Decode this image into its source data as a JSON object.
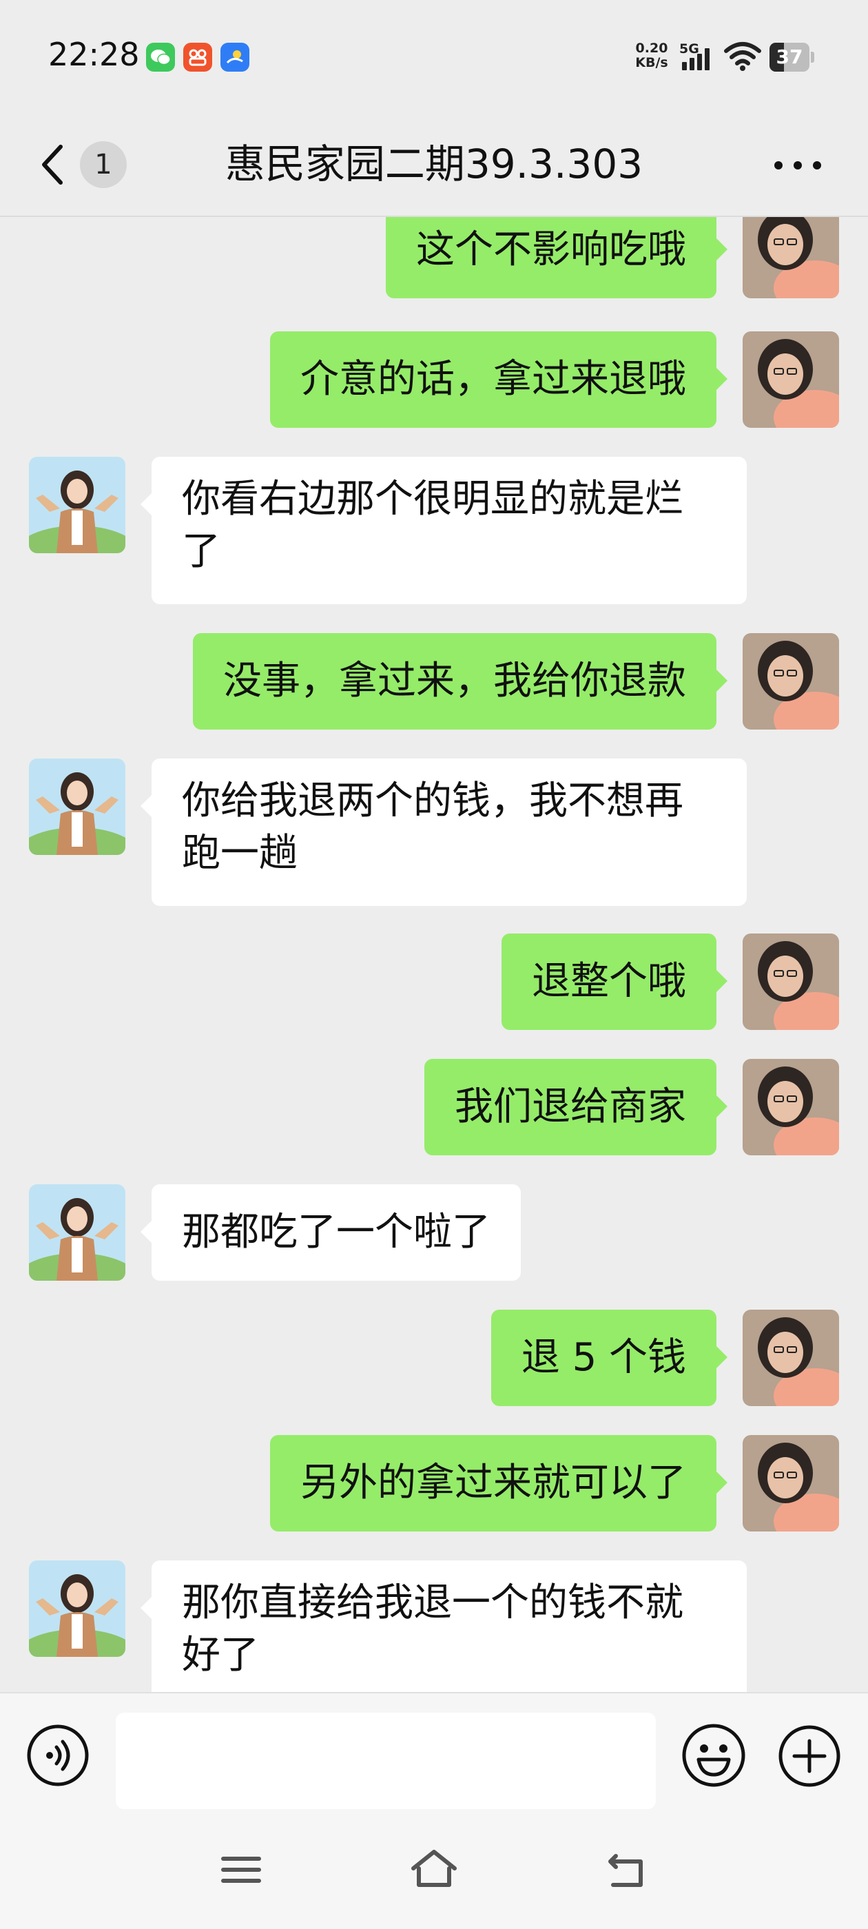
{
  "status_bar": {
    "time": "22:28",
    "net_speed_value": "0.20",
    "net_speed_unit": "KB/s",
    "network": "5G",
    "battery": "37",
    "battery_level_percent": 37,
    "apps": [
      "wechat-icon",
      "app-icon",
      "sun-app-icon"
    ]
  },
  "header": {
    "back_count": "1",
    "title": "惠民家园二期39.3.303"
  },
  "messages": [
    {
      "side": "right",
      "text": "这个不影响吃哦"
    },
    {
      "side": "right",
      "text": "介意的话，拿过来退哦"
    },
    {
      "side": "left",
      "text": "你看右边那个很明显的就是烂了"
    },
    {
      "side": "right",
      "text": "没事，拿过来，我给你退款"
    },
    {
      "side": "left",
      "text": "你给我退两个的钱，我不想再跑一趟"
    },
    {
      "side": "right",
      "text": "退整个哦"
    },
    {
      "side": "right",
      "text": "我们退给商家"
    },
    {
      "side": "left",
      "text": "那都吃了一个啦了"
    },
    {
      "side": "right",
      "text": "退 5 个钱"
    },
    {
      "side": "right",
      "text": "另外的拿过来就可以了"
    },
    {
      "side": "left",
      "text": "那你直接给我退一个的钱不就好了"
    }
  ],
  "input": {
    "value": ""
  },
  "colors": {
    "background": "#ededed",
    "sent_bubble": "#95ec69",
    "received_bubble": "#ffffff"
  }
}
